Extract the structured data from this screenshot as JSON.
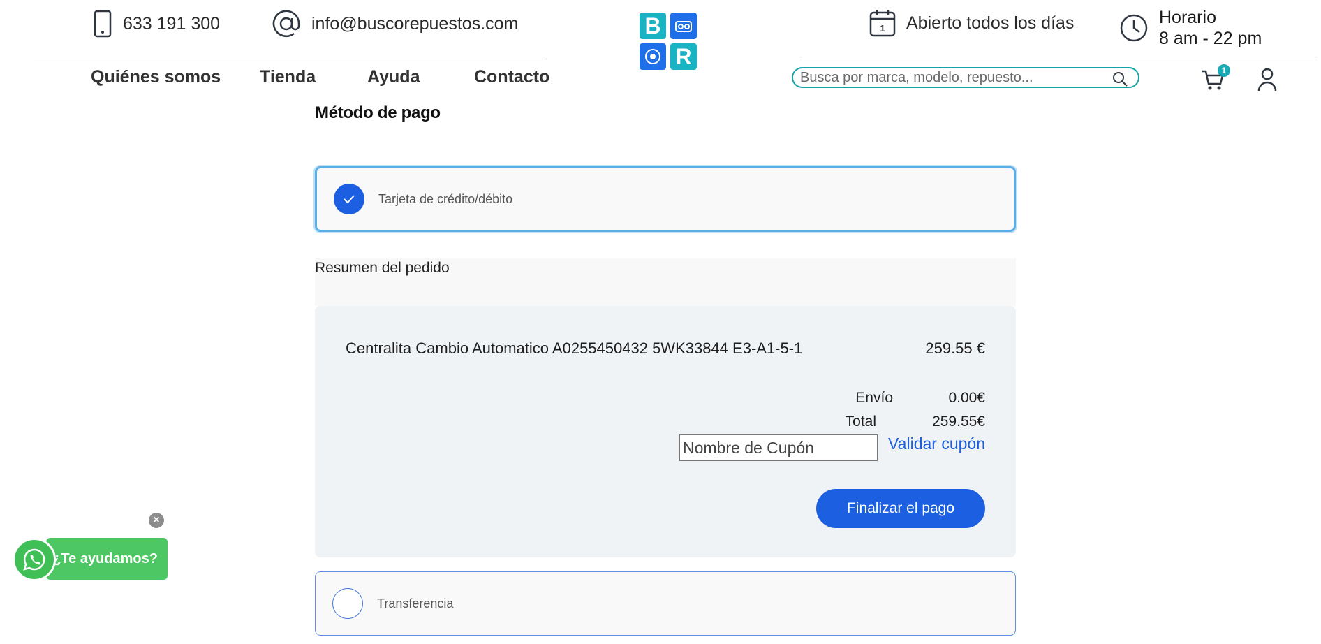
{
  "topbar": {
    "phone": "633 191 300",
    "email": "info@buscorepuestos.com",
    "open_days": "Abierto todos los días",
    "hours_label": "Horario",
    "hours_value": "8 am - 22 pm"
  },
  "logo": {
    "letters": [
      "B",
      "R"
    ],
    "colors": [
      "#19b3c4",
      "#1e6fe8",
      "#1e6fe8",
      "#19b3c4"
    ]
  },
  "nav": {
    "items": [
      "Quiénes somos",
      "Tienda",
      "Ayuda",
      "Contacto"
    ]
  },
  "search": {
    "placeholder": "Busca por marca, modelo, repuesto..."
  },
  "cart": {
    "count": "1"
  },
  "payment": {
    "heading": "Método de pago",
    "options": [
      {
        "label": "Tarjeta de crédito/débito",
        "selected": true
      },
      {
        "label": "Transferencia",
        "selected": false
      }
    ]
  },
  "summary": {
    "heading": "Resumen del pedido",
    "item_name": "Centralita Cambio Automatico A0255450432 5WK33844 E3-A1-5-1",
    "item_price": "259.55 €",
    "shipping_label": "Envío",
    "shipping_value": "0.00€",
    "total_label": "Total",
    "total_value": "259.55€",
    "coupon_placeholder": "Nombre de Cupón",
    "validate_label": "Validar cupón",
    "finish_label": "Finalizar el pago"
  },
  "whatsapp": {
    "label": "¿Te ayudamos?",
    "close": "×"
  },
  "colors": {
    "accent": "#1c5fe0",
    "teal": "#16a3a3",
    "whatsapp": "#4cc763"
  }
}
